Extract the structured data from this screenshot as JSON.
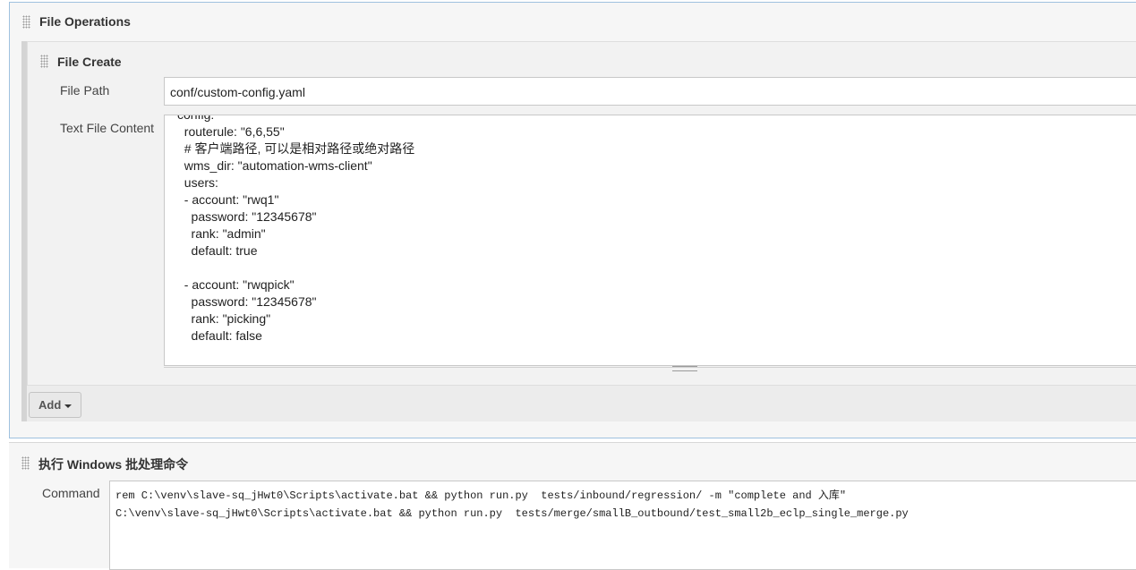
{
  "file_operations": {
    "title": "File Operations",
    "file_create": {
      "title": "File Create",
      "file_path_label": "File Path",
      "file_path_value": "conf/custom-config.yaml",
      "content_label": "Text File Content",
      "content_value": "config:\n  routerule: \"6,6,55\"\n  # 客户端路径, 可以是相对路径或绝对路径\n  wms_dir: \"automation-wms-client\"\n  users:\n  - account: \"rwq1\"\n    password: \"12345678\"\n    rank: \"admin\"\n    default: true\n\n  - account: \"rwqpick\"\n    password: \"12345678\"\n    rank: \"picking\"\n    default: false"
    },
    "add_button": "Add"
  },
  "batch": {
    "title": "执行 Windows 批处理命令",
    "command_label": "Command",
    "command_lines": [
      "rem C:\\venv\\slave-sq_jHwt0\\Scripts\\activate.bat && python run.py  tests/inbound/regression/ -m \"complete and 入库\"",
      "C:\\venv\\slave-sq_jHwt0\\Scripts\\activate.bat && python run.py  tests/merge/smallB_outbound/test_small2b_eclp_single_merge.py"
    ]
  }
}
